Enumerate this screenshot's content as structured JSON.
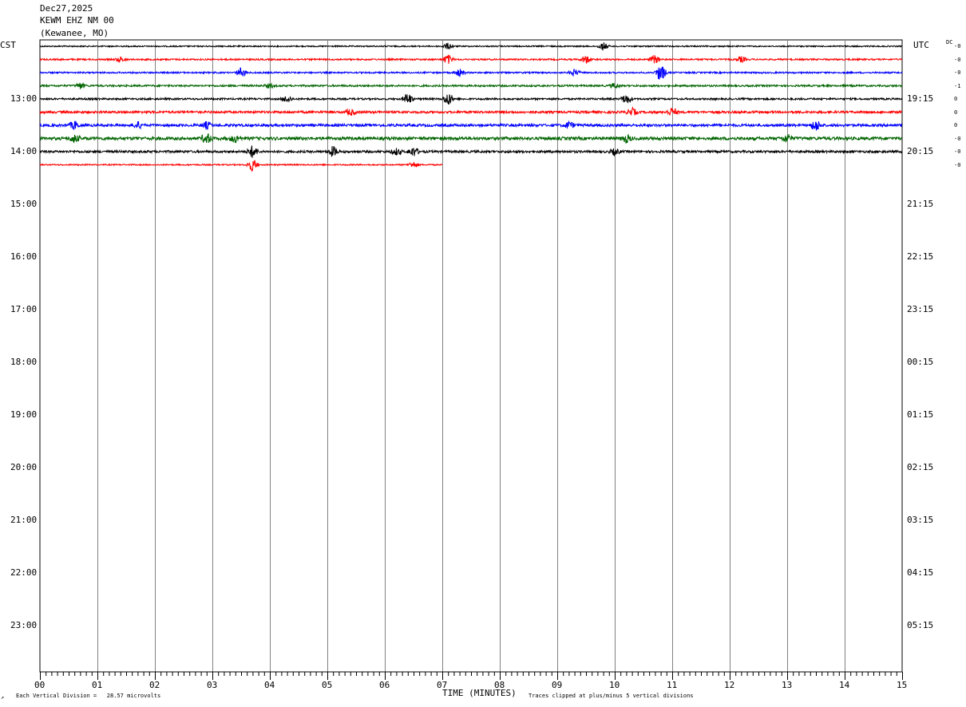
{
  "header": {
    "date": "Dec27,2025",
    "station": "KEWM EHZ NM 00",
    "location": "(Kewanee, MO)"
  },
  "labels": {
    "left_tz": "CST",
    "right_tz": "UTC",
    "dc_header": "DC",
    "x_axis_title": "TIME (MINUTES)",
    "scale_note": "Each Vertical Division =   28.57 microvolts",
    "clip_note": "Traces clipped at plus/minus 5 vertical divisions",
    "corner_mark": "↗"
  },
  "dc_values": [
    "-0",
    "-0",
    "-0",
    "-1",
    "0",
    "0",
    "0",
    "-0",
    "-0",
    "-0"
  ],
  "chart_data": {
    "type": "line",
    "title": "KEWM EHZ NM 00",
    "xlabel": "TIME (MINUTES)",
    "xlim": [
      0,
      15
    ],
    "x_ticks": [
      "00",
      "01",
      "02",
      "03",
      "04",
      "05",
      "06",
      "07",
      "08",
      "09",
      "10",
      "11",
      "12",
      "13",
      "14",
      "15"
    ],
    "hour_labels_cst": [
      "13:00",
      "14:00",
      "15:00",
      "16:00",
      "17:00",
      "18:00",
      "19:00",
      "20:00",
      "21:00",
      "22:00",
      "23:00"
    ],
    "hour_labels_utc": [
      "19:15",
      "20:15",
      "21:15",
      "22:15",
      "23:15",
      "00:15",
      "01:15",
      "02:15",
      "03:15",
      "04:15",
      "05:15"
    ],
    "trace_colors": [
      "#000000",
      "#ff0000",
      "#0000ff",
      "#006400"
    ],
    "traces": [
      {
        "start_cst": "12:00",
        "minutes": 15,
        "amplitude": 0.25,
        "events": [
          [
            7.1,
            1.2
          ],
          [
            9.8,
            1.5
          ]
        ]
      },
      {
        "start_cst": "12:15",
        "minutes": 15,
        "amplitude": 0.3,
        "events": [
          [
            1.4,
            0.9
          ],
          [
            7.1,
            1.8
          ],
          [
            9.5,
            1.5
          ],
          [
            10.7,
            1.6
          ],
          [
            12.2,
            1.1
          ]
        ]
      },
      {
        "start_cst": "12:30",
        "minutes": 15,
        "amplitude": 0.3,
        "events": [
          [
            3.5,
            1.8
          ],
          [
            7.3,
            1.5
          ],
          [
            9.3,
            1.3
          ],
          [
            10.8,
            3.5
          ]
        ]
      },
      {
        "start_cst": "12:45",
        "minutes": 15,
        "amplitude": 0.35,
        "events": [
          [
            0.7,
            1.2
          ],
          [
            4.0,
            0.8
          ],
          [
            10.0,
            1.0
          ]
        ]
      },
      {
        "start_cst": "13:00",
        "minutes": 15,
        "amplitude": 0.35,
        "events": [
          [
            4.3,
            1.3
          ],
          [
            6.4,
            2.2
          ],
          [
            7.1,
            2.5
          ],
          [
            10.2,
            1.8
          ]
        ]
      },
      {
        "start_cst": "13:15",
        "minutes": 15,
        "amplitude": 0.45,
        "events": [
          [
            5.4,
            1.2
          ],
          [
            10.3,
            1.5
          ],
          [
            11.0,
            1.6
          ]
        ]
      },
      {
        "start_cst": "13:30",
        "minutes": 15,
        "amplitude": 0.5,
        "events": [
          [
            0.6,
            1.5
          ],
          [
            1.7,
            1.3
          ],
          [
            2.9,
            1.3
          ],
          [
            9.2,
            1.3
          ],
          [
            13.5,
            2.2
          ]
        ]
      },
      {
        "start_cst": "13:45",
        "minutes": 15,
        "amplitude": 0.6,
        "events": [
          [
            0.6,
            1.4
          ],
          [
            2.9,
            2.0
          ],
          [
            3.4,
            1.4
          ],
          [
            10.2,
            1.5
          ],
          [
            13.0,
            1.5
          ]
        ]
      },
      {
        "start_cst": "14:00",
        "minutes": 15,
        "amplitude": 0.45,
        "events": [
          [
            3.7,
            2.3
          ],
          [
            5.1,
            2.0
          ],
          [
            6.2,
            1.2
          ],
          [
            6.5,
            1.8
          ],
          [
            10.0,
            1.2
          ]
        ]
      },
      {
        "start_cst": "14:15",
        "minutes": 7,
        "amplitude": 0.25,
        "events": [
          [
            3.7,
            2.5
          ],
          [
            6.5,
            1.2
          ]
        ]
      }
    ]
  }
}
